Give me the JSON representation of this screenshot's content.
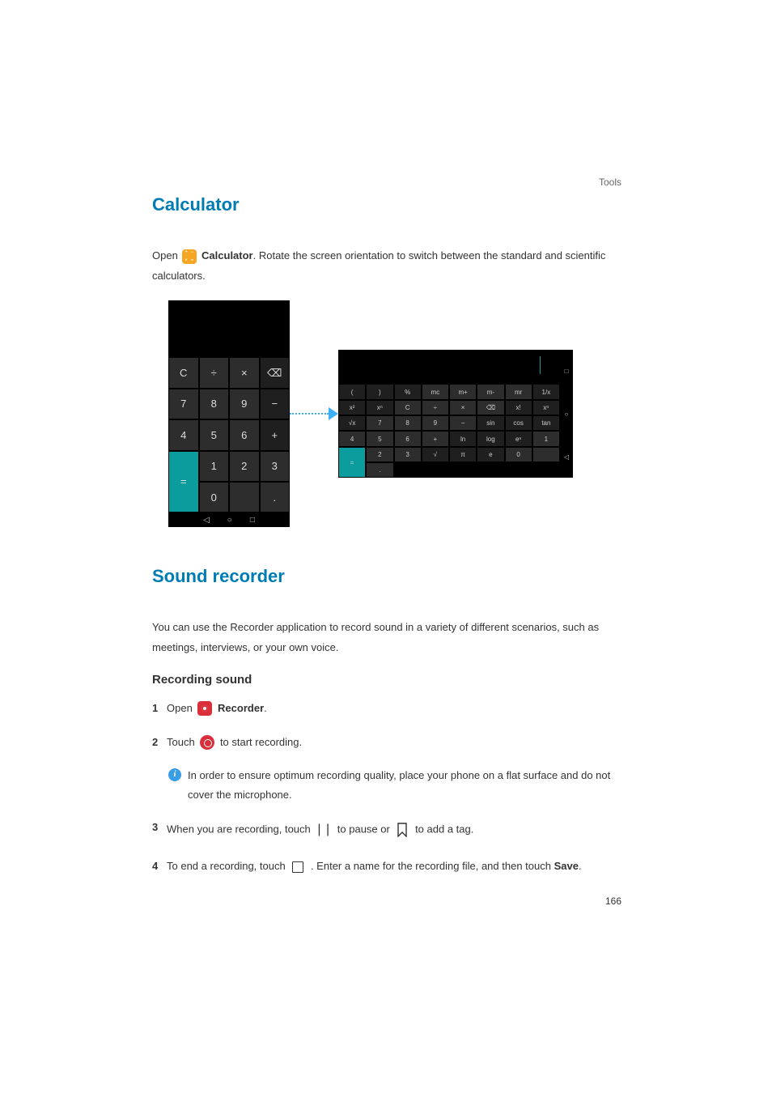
{
  "header": {
    "section": "Tools"
  },
  "calculator": {
    "heading": "Calculator",
    "intro_pre": "Open ",
    "intro_bold": "Calculator",
    "intro_post": ". Rotate the screen orientation to switch between the standard and scientific calculators.",
    "portrait_keys": [
      [
        "C",
        "÷",
        "×",
        "⌫"
      ],
      [
        "7",
        "8",
        "9",
        "−"
      ],
      [
        "4",
        "5",
        "6",
        "+"
      ],
      [
        "1",
        "2",
        "3",
        "="
      ],
      [
        "0",
        "",
        ".",
        "="
      ]
    ],
    "portrait_nav": [
      "◁",
      "○",
      "□"
    ],
    "landscape_keys": [
      [
        "(",
        ")",
        "%",
        "mc",
        "m+",
        "m-",
        "mr",
        ""
      ],
      [
        "1/x",
        "x²",
        "xⁿ",
        "C",
        "÷",
        "×",
        "⌫",
        ""
      ],
      [
        "x!",
        "xⁿ",
        "√x",
        "7",
        "8",
        "9",
        "−",
        ""
      ],
      [
        "sin",
        "cos",
        "tan",
        "4",
        "5",
        "6",
        "+",
        ""
      ],
      [
        "ln",
        "log",
        "eⁿ",
        "1",
        "2",
        "3",
        "=",
        ""
      ],
      [
        "√",
        "π",
        "e",
        "0",
        "",
        ".",
        "=",
        ""
      ]
    ],
    "landscape_nav": [
      "□",
      "○",
      "◁"
    ]
  },
  "recorder": {
    "heading": "Sound recorder",
    "intro": "You can use the Recorder application to record sound in a variety of different scenarios, such as meetings, interviews, or your own voice.",
    "subhead": "Recording  sound",
    "step1_pre": "Open ",
    "step1_bold": "Recorder",
    "step1_post": ".",
    "step2_pre": "Touch ",
    "step2_post": " to start recording.",
    "note": "In order to ensure optimum recording quality, place your phone on a flat surface and do not cover the microphone.",
    "step3_pre": "When you are recording, touch ",
    "step3_mid": " to pause or ",
    "step3_post": " to add a tag.",
    "step4_pre": "To end a recording, touch ",
    "step4_mid": " . Enter a name for the recording file, and then touch ",
    "step4_bold": "Save",
    "step4_post": "."
  },
  "page_number": "166"
}
